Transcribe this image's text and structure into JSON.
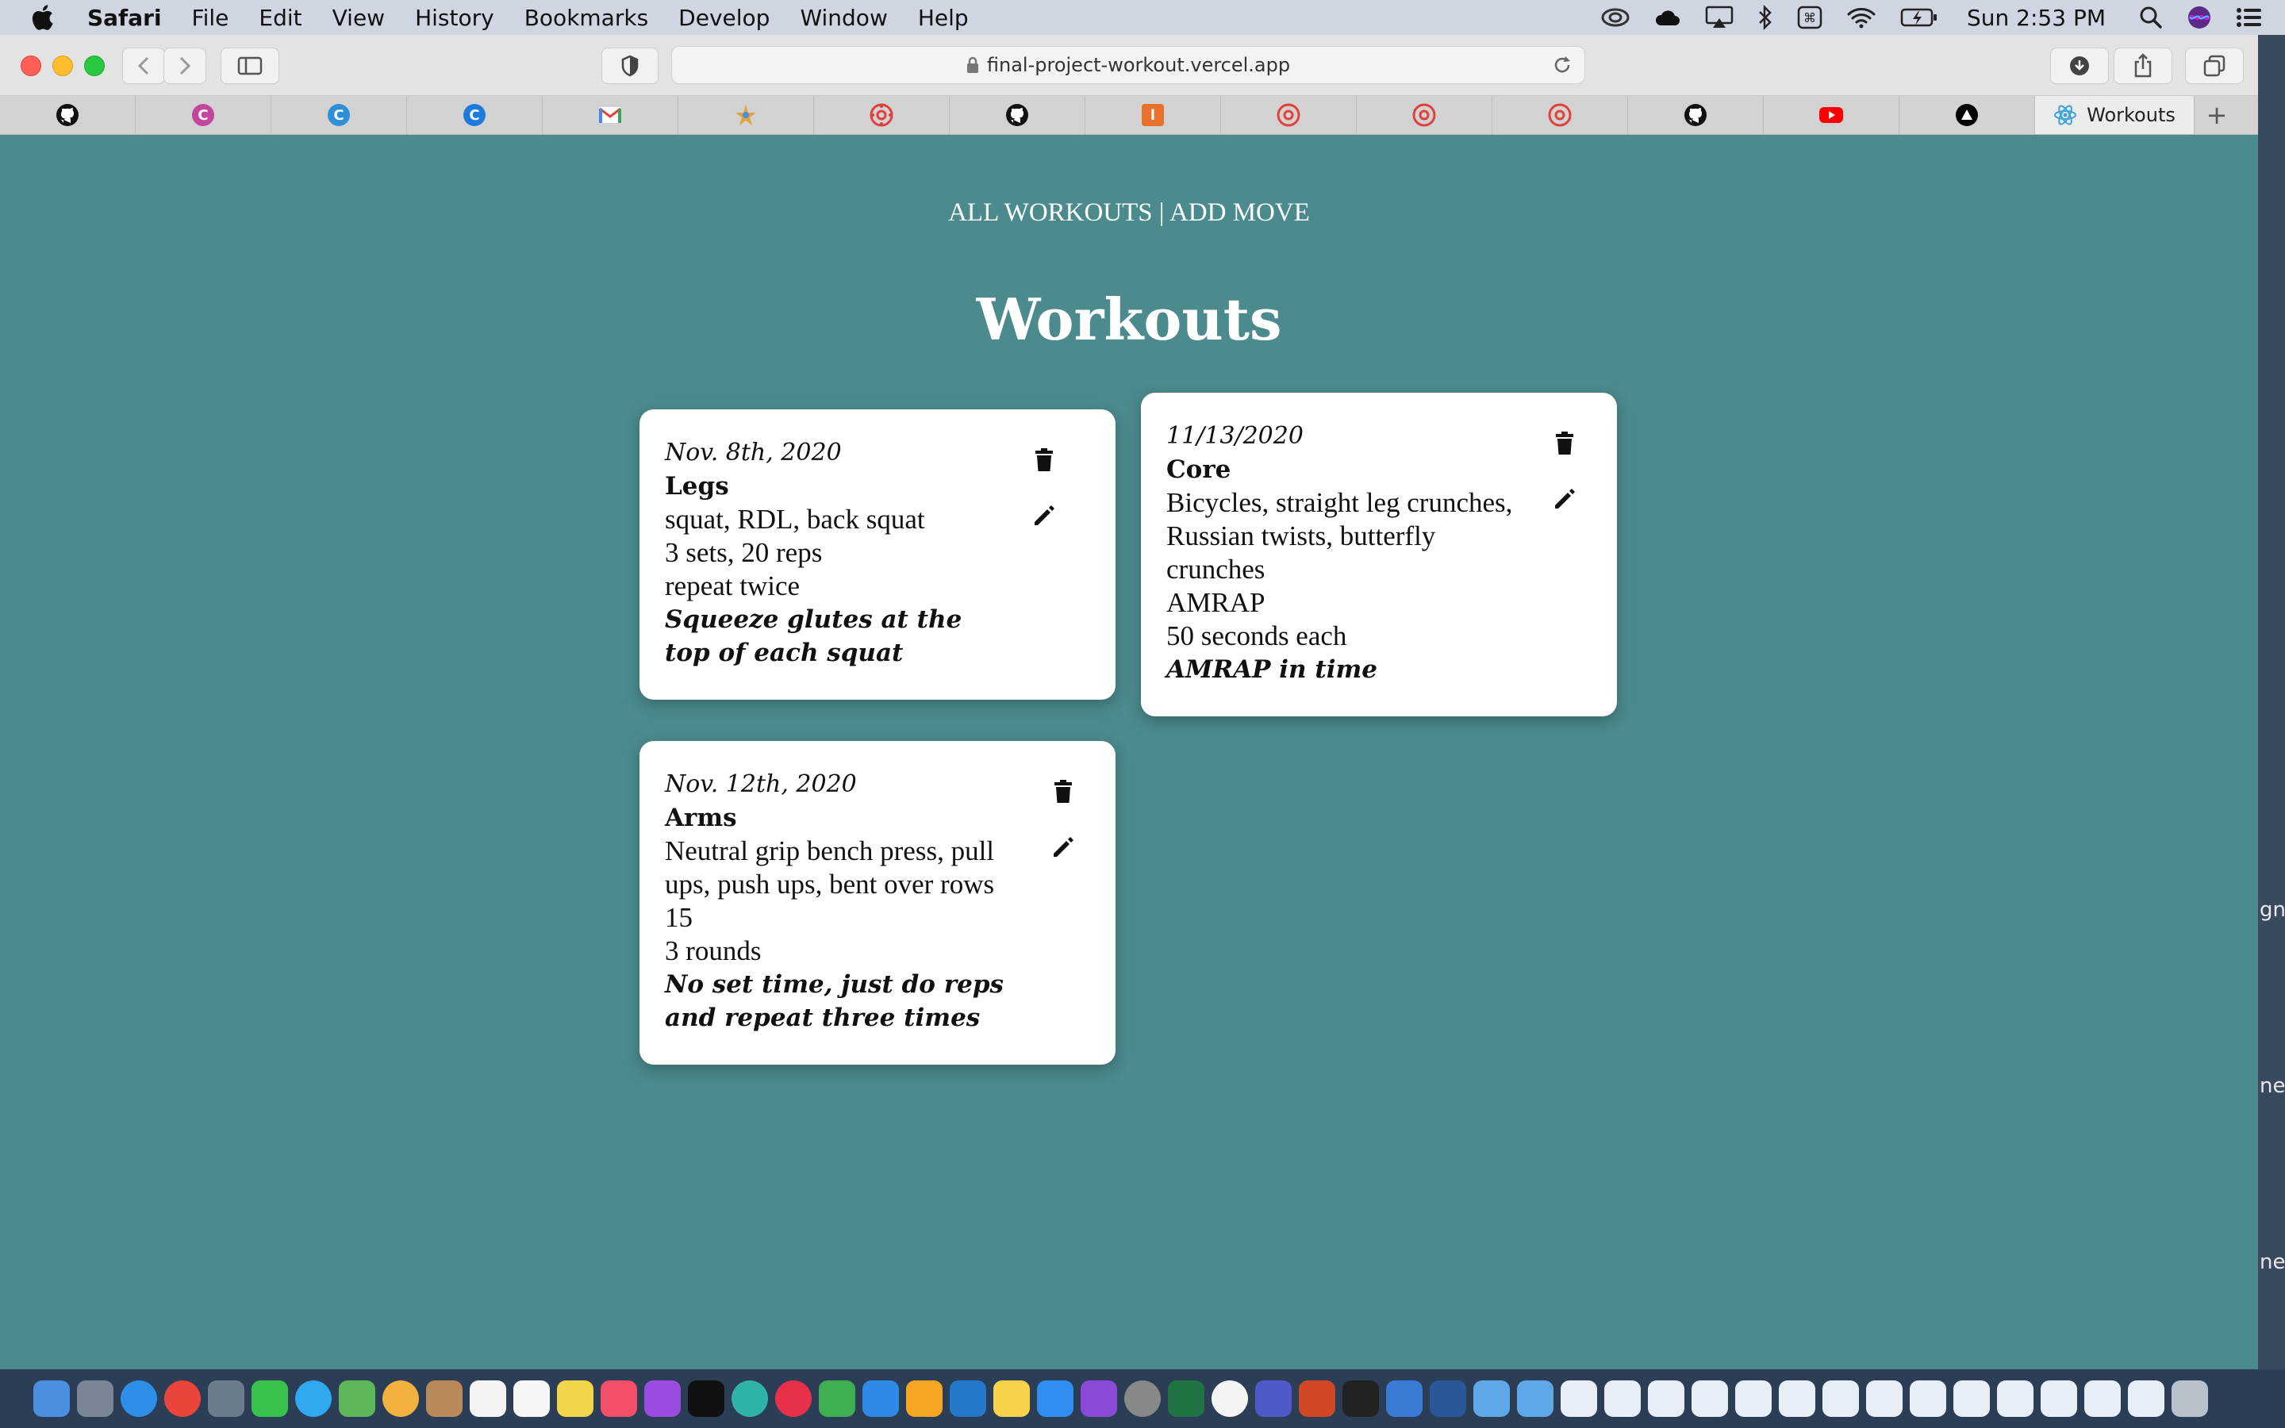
{
  "menubar": {
    "app_name": "Safari",
    "items": [
      "File",
      "Edit",
      "View",
      "History",
      "Bookmarks",
      "Develop",
      "Window",
      "Help"
    ],
    "clock": "Sun 2:53 PM"
  },
  "browser": {
    "url": "final-project-workout.vercel.app",
    "active_tab_label": "Workouts",
    "tab_icons": [
      "github-icon",
      "c-icon",
      "c-icon",
      "c-icon",
      "gmail-icon",
      "star-icon",
      "canvas-icon",
      "github-icon",
      "orange-app-icon",
      "canvas-icon",
      "canvas-icon",
      "canvas-icon",
      "github-icon",
      "youtube-icon",
      "vercel-icon"
    ]
  },
  "page": {
    "nav": {
      "all_workouts": "ALL WORKOUTS",
      "separator": "|",
      "add_move": "ADD MOVE"
    },
    "heading": "Workouts",
    "workouts": [
      {
        "date": "Nov. 8th, 2020",
        "name": "Legs",
        "moves": "squat, RDL, back squat",
        "sets_reps": "3 sets, 20 reps",
        "rounds": "repeat twice",
        "note": "Squeeze glutes at the top of each squat"
      },
      {
        "date": "11/13/2020",
        "name": "Core",
        "moves": "Bicycles, straight leg crunches, Russian twists, butterfly crunches",
        "sets_reps": "AMRAP",
        "rounds": "50 seconds each",
        "note": "AMRAP in time"
      },
      {
        "date": "Nov. 12th, 2020",
        "name": "Arms",
        "moves": "Neutral grip bench press, pull ups, push ups, bent over rows",
        "sets_reps": "15",
        "rounds": "3 rounds",
        "note": "No set time, just do reps and repeat three times"
      }
    ]
  },
  "desktop_text": [
    "gn",
    "ne",
    "ne"
  ],
  "colors": {
    "page_background": "#4b8a8d",
    "card_background": "#ffffff"
  }
}
